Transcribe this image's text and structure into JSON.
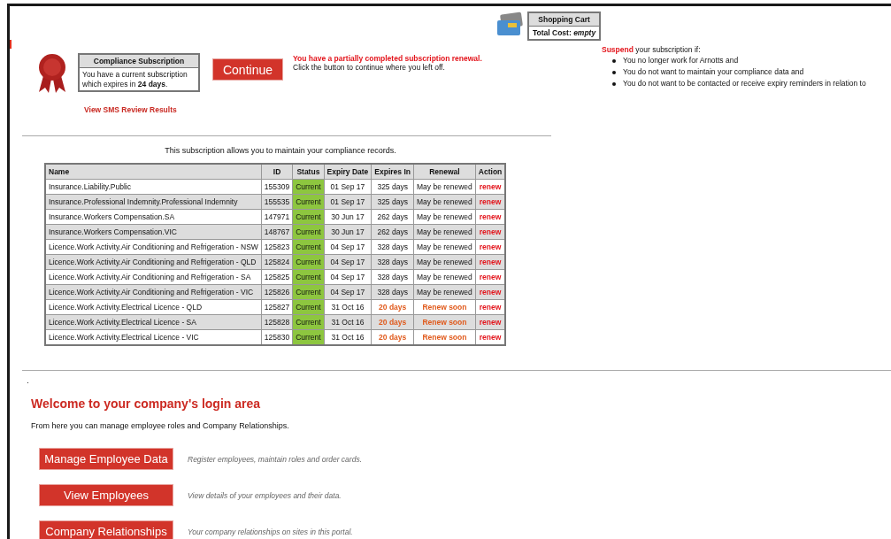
{
  "cart": {
    "title": "Shopping Cart",
    "cost_label": "Total Cost:",
    "cost_value": "empty"
  },
  "subscription": {
    "title": "Compliance Subscription",
    "text": "You have a current subscription which expires in **24 days**.",
    "link": "View SMS Review Results"
  },
  "continue_button": "Continue",
  "renewal_notice": {
    "headline": "You have a partially completed subscription renewal.",
    "text": "Click the button to continue where you left off."
  },
  "suspend": {
    "intro": "**Suspend** your subscription if:",
    "items": [
      "You no longer work for Arnotts and",
      "You do not want to maintain your compliance data and",
      "You do not want to be contacted or receive expiry reminders in relation to"
    ]
  },
  "table_caption": "This subscription allows you to maintain your compliance records.",
  "table": {
    "columns": [
      "Name",
      "ID",
      "Status",
      "Expiry Date",
      "Expires In",
      "Renewal",
      "Action"
    ],
    "rows": [
      {
        "name": "Insurance.Liability.Public",
        "id": "155309",
        "status": "Current",
        "expiry": "01 Sep 17",
        "expires_in": "325 days",
        "renewal": "May be renewed",
        "action": "renew",
        "urgent": false
      },
      {
        "name": "Insurance.Professional Indemnity.Professional Indemnity",
        "id": "155535",
        "status": "Current",
        "expiry": "01 Sep 17",
        "expires_in": "325 days",
        "renewal": "May be renewed",
        "action": "renew",
        "urgent": false
      },
      {
        "name": "Insurance.Workers Compensation.SA",
        "id": "147971",
        "status": "Current",
        "expiry": "30 Jun 17",
        "expires_in": "262 days",
        "renewal": "May be renewed",
        "action": "renew",
        "urgent": false
      },
      {
        "name": "Insurance.Workers Compensation.VIC",
        "id": "148767",
        "status": "Current",
        "expiry": "30 Jun 17",
        "expires_in": "262 days",
        "renewal": "May be renewed",
        "action": "renew",
        "urgent": false
      },
      {
        "name": "Licence.Work Activity.Air Conditioning and Refrigeration - NSW",
        "id": "125823",
        "status": "Current",
        "expiry": "04 Sep 17",
        "expires_in": "328 days",
        "renewal": "May be renewed",
        "action": "renew",
        "urgent": false
      },
      {
        "name": "Licence.Work Activity.Air Conditioning and Refrigeration - QLD",
        "id": "125824",
        "status": "Current",
        "expiry": "04 Sep 17",
        "expires_in": "328 days",
        "renewal": "May be renewed",
        "action": "renew",
        "urgent": false
      },
      {
        "name": "Licence.Work Activity.Air Conditioning and Refrigeration - SA",
        "id": "125825",
        "status": "Current",
        "expiry": "04 Sep 17",
        "expires_in": "328 days",
        "renewal": "May be renewed",
        "action": "renew",
        "urgent": false
      },
      {
        "name": "Licence.Work Activity.Air Conditioning and Refrigeration - VIC",
        "id": "125826",
        "status": "Current",
        "expiry": "04 Sep 17",
        "expires_in": "328 days",
        "renewal": "May be renewed",
        "action": "renew",
        "urgent": false
      },
      {
        "name": "Licence.Work Activity.Electrical Licence - QLD",
        "id": "125827",
        "status": "Current",
        "expiry": "31 Oct 16",
        "expires_in": "20 days",
        "renewal": "Renew soon",
        "action": "renew",
        "urgent": true
      },
      {
        "name": "Licence.Work Activity.Electrical Licence - SA",
        "id": "125828",
        "status": "Current",
        "expiry": "31 Oct 16",
        "expires_in": "20 days",
        "renewal": "Renew soon",
        "action": "renew",
        "urgent": true
      },
      {
        "name": "Licence.Work Activity.Electrical Licence - VIC",
        "id": "125830",
        "status": "Current",
        "expiry": "31 Oct 16",
        "expires_in": "20 days",
        "renewal": "Renew soon",
        "action": "renew",
        "urgent": true
      }
    ]
  },
  "welcome": {
    "heading": "Welcome to your company's login area",
    "text": "From here you can manage employee roles and Company Relationships."
  },
  "actions": [
    {
      "label": "Manage Employee Data",
      "description": "Register employees, maintain roles and order cards."
    },
    {
      "label": "View Employees",
      "description": "View details of your employees and their data."
    },
    {
      "label": "Company Relationships",
      "description": "Your company relationships on sites in this portal."
    }
  ]
}
